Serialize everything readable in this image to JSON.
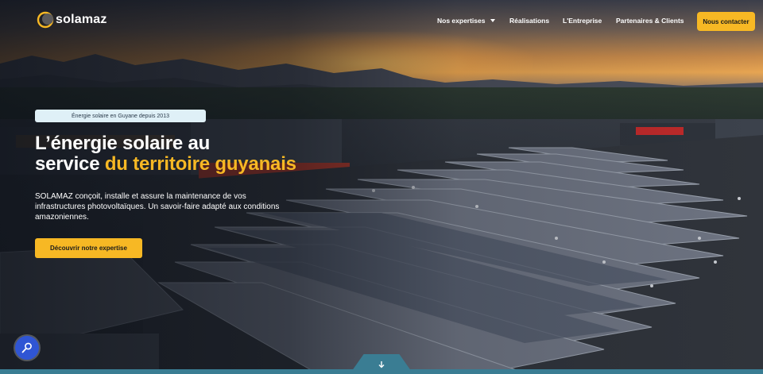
{
  "brand": {
    "name": "solamaz",
    "accent_color": "#f7b824",
    "logo_icon": "crescent-sun-icon"
  },
  "nav": {
    "items": [
      {
        "label": "Nos expertises",
        "has_dropdown": true
      },
      {
        "label": "Réalisations",
        "has_dropdown": false
      },
      {
        "label": "L'Entreprise",
        "has_dropdown": false
      },
      {
        "label": "Partenaires & Clients",
        "has_dropdown": false
      }
    ],
    "contact_label": "Nous contacter"
  },
  "hero": {
    "badge": "Énergie solaire en Guyane depuis 2013",
    "title_line1": "L’énergie solaire au",
    "title_line2_plain": "service ",
    "title_line2_accent": "du territoire guyanais",
    "description": "SOLAMAZ conçoit, installe et assure la maintenance de vos infrastructures photovoltaïques. Un savoir-faire adapté aux conditions amazoniennes.",
    "cta_label": "Découvrir notre expertise"
  },
  "widgets": {
    "accessibility_icon": "accessibility-icon",
    "scroll_icon": "arrow-down-icon",
    "accessibility_color": "#2f55d4",
    "strip_color": "#3a7d93"
  }
}
